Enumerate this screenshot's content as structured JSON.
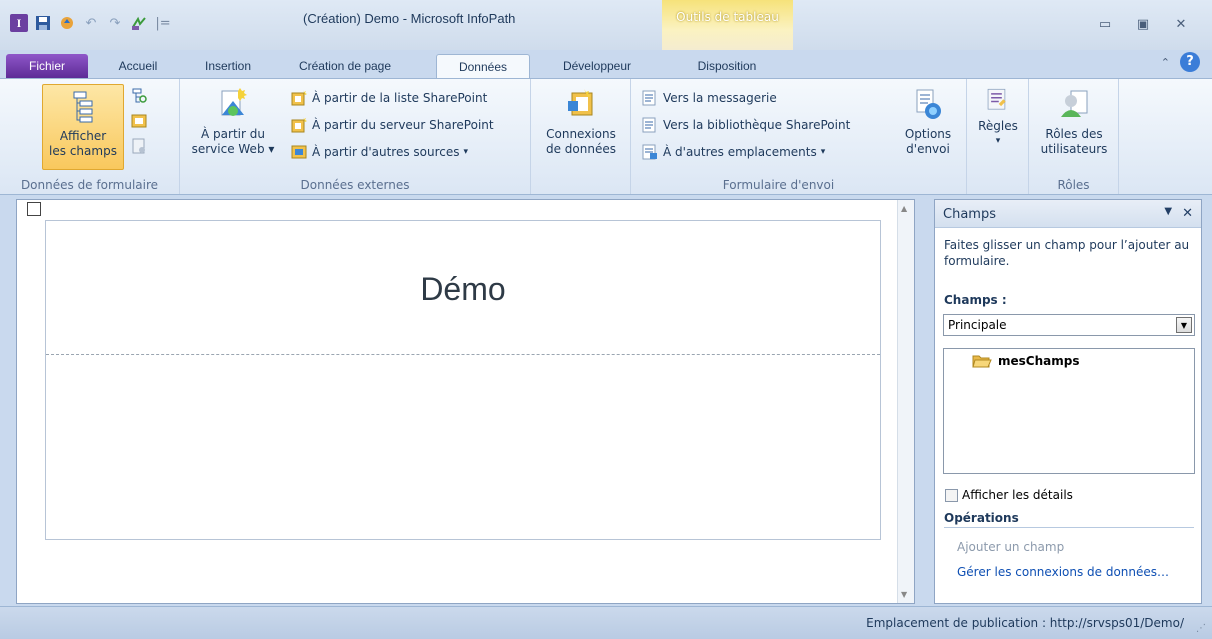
{
  "window": {
    "title": "(Création) Demo  -  Microsoft InfoPath",
    "context_tab_title": "Outils de tableau",
    "controls": [
      "minimize-icon",
      "maximize-icon",
      "close-icon"
    ]
  },
  "quick_access": [
    "infopath-app-icon",
    "save-icon",
    "preview-icon",
    "undo-icon",
    "redo-icon",
    "publish-icon",
    "customize-icon"
  ],
  "tabs": [
    {
      "label": "Fichier"
    },
    {
      "label": "Accueil"
    },
    {
      "label": "Insertion"
    },
    {
      "label": "Création de page"
    },
    {
      "label": "Données"
    },
    {
      "label": "Développeur"
    },
    {
      "label": "Disposition"
    }
  ],
  "ribbon": {
    "groups": {
      "form_data": {
        "label": "Données de formulaire",
        "show_fields_line1": "Afficher",
        "show_fields_line2": "les champs"
      },
      "external_data": {
        "label": "Données externes",
        "web_service_line1": "À partir du",
        "web_service_line2": "service Web",
        "sharepoint_list": "À partir de la liste SharePoint",
        "sharepoint_server": "À partir du serveur SharePoint",
        "other_sources": "À partir d'autres sources"
      },
      "connections": {
        "line1": "Connexions",
        "line2": "de données"
      },
      "submit": {
        "label": "Formulaire d'envoi",
        "to_email": "Vers la messagerie",
        "to_sharepoint_library": "Vers la bibliothèque SharePoint",
        "to_other": "À d'autres emplacements",
        "options_line1": "Options",
        "options_line2": "d'envoi"
      },
      "rules": {
        "label": "Règles"
      },
      "roles": {
        "label": "Rôles",
        "user_roles_line1": "Rôles des",
        "user_roles_line2": "utilisateurs"
      }
    }
  },
  "form": {
    "title": "Démo"
  },
  "taskpane": {
    "title": "Champs",
    "description": "Faites glisser un champ pour l’ajouter au formulaire.",
    "fields_label": "Champs :",
    "source_selected": "Principale",
    "tree": [
      {
        "label": "mesChamps",
        "icon": "folder-open-icon"
      }
    ],
    "show_details": "Afficher les détails",
    "operations_label": "Opérations",
    "add_field": "Ajouter un champ",
    "manage_connections": "Gérer les connexions de données…"
  },
  "status": {
    "publish_location": "Emplacement de publication : http://srvsps01/Demo/"
  },
  "colors": {
    "file_tab": "#6b3fa0",
    "context_tab": "#f6e27a",
    "link": "#0e4fb3"
  }
}
